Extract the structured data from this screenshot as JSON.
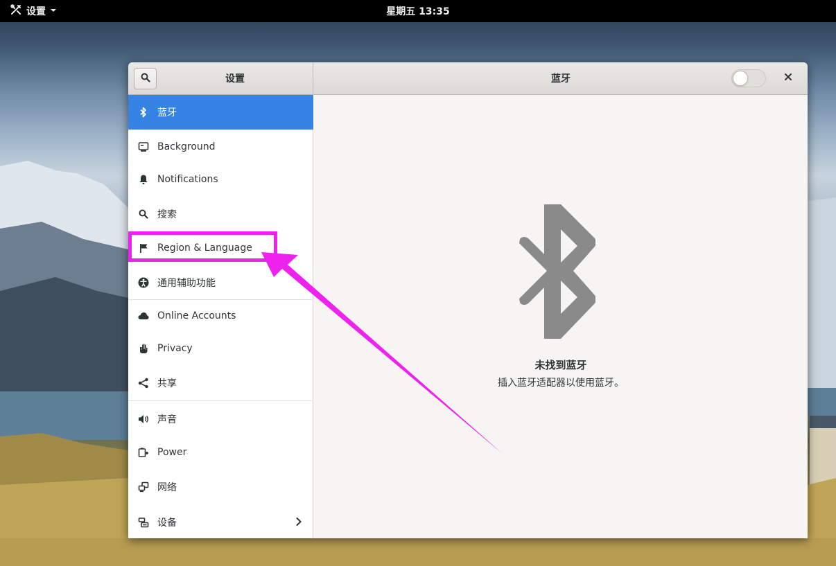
{
  "topbar": {
    "app_name": "设置",
    "clock": "星期五 13:35"
  },
  "window": {
    "sidebar_title": "设置",
    "panel_title": "蓝牙",
    "bluetooth_switch_on": false
  },
  "sidebar": {
    "items": [
      {
        "label": "蓝牙",
        "icon": "bluetooth-icon"
      },
      {
        "label": "Background",
        "icon": "background-icon"
      },
      {
        "label": "Notifications",
        "icon": "bell-icon"
      },
      {
        "label": "搜索",
        "icon": "search-icon"
      },
      {
        "label": "Region & Language",
        "icon": "flag-icon"
      },
      {
        "label": "通用辅助功能",
        "icon": "accessibility-icon"
      },
      {
        "label": "Online Accounts",
        "icon": "cloud-icon"
      },
      {
        "label": "Privacy",
        "icon": "hand-icon"
      },
      {
        "label": "共享",
        "icon": "share-icon"
      },
      {
        "label": "声音",
        "icon": "speaker-icon"
      },
      {
        "label": "Power",
        "icon": "power-plug-icon"
      },
      {
        "label": "网络",
        "icon": "network-icon"
      },
      {
        "label": "设备",
        "icon": "devices-icon"
      }
    ]
  },
  "content": {
    "empty_title": "未找到蓝牙",
    "empty_subtitle": "插入蓝牙适配器以使用蓝牙。"
  },
  "colors": {
    "accent": "#3584e4",
    "annotation": "#ee22ee",
    "icon_gray": "#8a8a8a"
  }
}
